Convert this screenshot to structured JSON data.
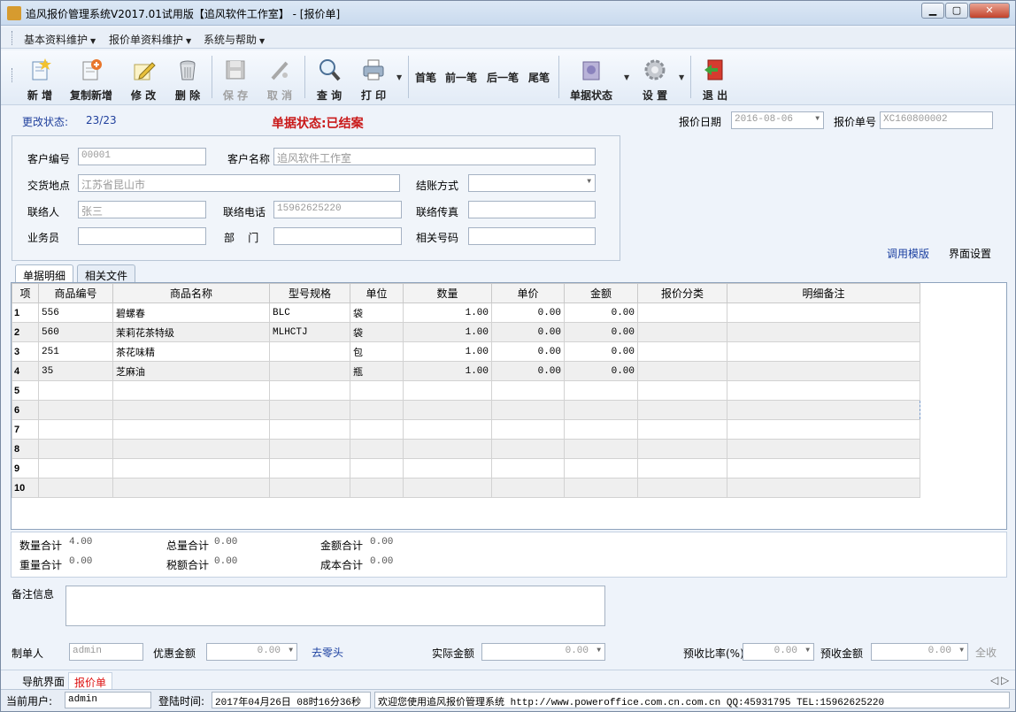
{
  "window": {
    "title": "追风报价管理系统V2017.01试用版【追风软件工作室】 - [报价单]",
    "min": "▁",
    "max": "▢",
    "close": "✕"
  },
  "menu": [
    "基本资料维护",
    "报价单资料维护",
    "系统与帮助"
  ],
  "toolbar": {
    "add": "新 增",
    "copy_add": "复制新增",
    "edit": "修 改",
    "delete": "删 除",
    "save": "保 存",
    "cancel": "取 消",
    "query": "查 询",
    "print": "打 印",
    "first": "首笔",
    "prev": "前一笔",
    "next": "后一笔",
    "last": "尾笔",
    "doc_status": "单据状态",
    "settings": "设 置",
    "exit": "退 出"
  },
  "header": {
    "change_status_label": "更改状态:",
    "change_status_value": "23/23",
    "doc_status": "单据状态:已结案",
    "date_label": "报价日期",
    "date_value": "2016-08-06",
    "no_label": "报价单号",
    "no_value": "XC160800002"
  },
  "form": {
    "customer_no_label": "客户编号",
    "customer_no": "00001",
    "customer_name_label": "客户名称",
    "customer_name": "追风软件工作室",
    "delivery_label": "交货地点",
    "delivery": "江苏省昆山市",
    "settle_label": "结账方式",
    "settle": "",
    "contact_label": "联络人",
    "contact": "张三",
    "phone_label": "联络电话",
    "phone": "15962625220",
    "fax_label": "联络传真",
    "fax": "",
    "sales_label": "业务员",
    "sales": "",
    "dept_label": "部    门",
    "dept": "",
    "ref_label": "相关号码",
    "ref": ""
  },
  "links": {
    "template": "调用模版",
    "ui_settings": "界面设置"
  },
  "tabs": [
    "单据明细",
    "相关文件"
  ],
  "grid": {
    "columns": [
      "项",
      "商品编号",
      "商品名称",
      "型号规格",
      "单位",
      "数量",
      "单价",
      "金额",
      "报价分类",
      "明细备注"
    ],
    "rows": [
      [
        "1",
        "556",
        "碧螺春",
        "BLC",
        "袋",
        "1.00",
        "0.00",
        "0.00",
        "",
        ""
      ],
      [
        "2",
        "560",
        "茉莉花茶特级",
        "MLHCTJ",
        "袋",
        "1.00",
        "0.00",
        "0.00",
        "",
        ""
      ],
      [
        "3",
        "251",
        "茶花味精",
        "",
        "包",
        "1.00",
        "0.00",
        "0.00",
        "",
        ""
      ],
      [
        "4",
        "35",
        "芝麻油",
        "",
        "瓶",
        "1.00",
        "0.00",
        "0.00",
        "",
        ""
      ],
      [
        "5",
        "",
        "",
        "",
        "",
        "",
        "",
        "",
        "",
        ""
      ],
      [
        "6",
        "",
        "",
        "",
        "",
        "",
        "",
        "",
        "",
        ""
      ],
      [
        "7",
        "",
        "",
        "",
        "",
        "",
        "",
        "",
        "",
        ""
      ],
      [
        "8",
        "",
        "",
        "",
        "",
        "",
        "",
        "",
        "",
        ""
      ],
      [
        "9",
        "",
        "",
        "",
        "",
        "",
        "",
        "",
        "",
        ""
      ],
      [
        "10",
        "",
        "",
        "",
        "",
        "",
        "",
        "",
        "",
        ""
      ]
    ]
  },
  "summary": {
    "qty_label": "数量合计",
    "qty": "4.00",
    "total_label": "总量合计",
    "total": "0.00",
    "amount_label": "金额合计",
    "amount": "0.00",
    "weight_label": "重量合计",
    "weight": "0.00",
    "tax_label": "税额合计",
    "tax": "0.00",
    "cost_label": "成本合计",
    "cost": "0.00"
  },
  "remark_label": "备注信息",
  "footer": {
    "maker_label": "制单人",
    "maker": "admin",
    "discount_label": "优惠金额",
    "discount": "0.00",
    "round_link": "去零头",
    "actual_label": "实际金额",
    "actual": "0.00",
    "prepay_rate_label": "预收比率(%)",
    "prepay_rate": "0.00",
    "prepay_amt_label": "预收金额",
    "prepay_amt": "0.00",
    "full": "全收"
  },
  "bottom_tabs": [
    "导航界面",
    "报价单"
  ],
  "statusbar": {
    "user_label": "当前用户:",
    "user": "admin",
    "login_label": "登陆时间:",
    "login_time": "2017年04月26日 08时16分36秒",
    "welcome": "欢迎您使用追风报价管理系统 http://www.poweroffice.com.cn.com.cn QQ:45931795 TEL:15962625220"
  }
}
